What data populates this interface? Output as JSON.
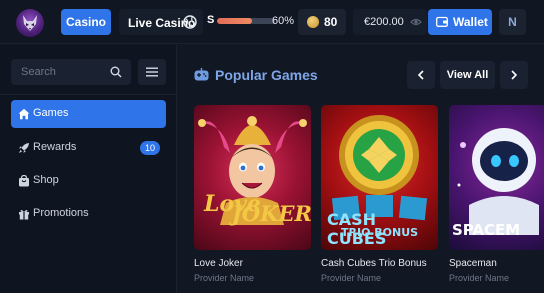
{
  "header": {
    "casino_label": "Casino",
    "live_label": "Live Casino",
    "sports_letter": "S",
    "progress_percent": "60%",
    "progress_value": 0.6,
    "coins": "80",
    "balance": "€200.00",
    "wallet_label": "Wallet",
    "avatar_initial": "N"
  },
  "sidebar": {
    "search_placeholder": "Search",
    "items": [
      {
        "label": "Games",
        "icon": "home-icon",
        "active": true
      },
      {
        "label": "Rewards",
        "icon": "rocket-icon",
        "badge": "10"
      },
      {
        "label": "Shop",
        "icon": "shop-icon"
      },
      {
        "label": "Promotions",
        "icon": "gift-icon"
      }
    ]
  },
  "main": {
    "section_title": "Popular Games",
    "view_all": "View All",
    "games": [
      {
        "title": "Love Joker",
        "provider": "Provider Name",
        "art_line1": "Love",
        "art_line2": "JOKER"
      },
      {
        "title": "Cash Cubes Trio Bonus",
        "provider": "Provider Name",
        "art_line1": "CASH CUBES",
        "art_line2": "TRIO BONUS"
      },
      {
        "title": "Spaceman",
        "provider": "Provider Name",
        "art_line1": "SPACEM"
      }
    ]
  },
  "colors": {
    "accent": "#2f74e8",
    "background": "#111723",
    "section_title": "#7ea6e6"
  }
}
